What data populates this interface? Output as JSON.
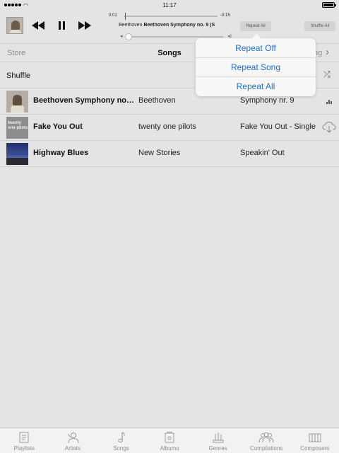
{
  "status_bar": {
    "time": "11:17",
    "battery_level": 1.0
  },
  "now_playing": {
    "elapsed": "0:01",
    "remaining": "-0:15",
    "progress": 0.01,
    "title_artist": "Beethoven",
    "title_track": "Beethoven Symphony no. 9 (S",
    "volume": 0.03,
    "repeat_label": "Repeat All",
    "shuffle_label": "Shuffle All"
  },
  "segment_bar": {
    "store": "Store",
    "title": "Songs",
    "right_label": "ng"
  },
  "shuffle_row": {
    "label": "Shuffle"
  },
  "songs": [
    {
      "title": "Beethoven Symphony no.…",
      "artist": "Beethoven",
      "album": "Symphony nr. 9",
      "status": "playing"
    },
    {
      "title": "Fake You Out",
      "artist": "twenty one pilots",
      "album": "Fake You Out - Single",
      "status": "cloud",
      "art_text": "twenty one pilots"
    },
    {
      "title": "Highway Blues",
      "artist": "New Stories",
      "album": "Speakin' Out",
      "status": ""
    }
  ],
  "repeat_menu": {
    "items": [
      "Repeat Off",
      "Repeat Song",
      "Repeat All"
    ]
  },
  "tabs": [
    {
      "label": "Playlists",
      "icon": "playlists-icon"
    },
    {
      "label": "Artists",
      "icon": "artists-icon"
    },
    {
      "label": "Songs",
      "icon": "songs-icon"
    },
    {
      "label": "Albums",
      "icon": "albums-icon"
    },
    {
      "label": "Genres",
      "icon": "genres-icon"
    },
    {
      "label": "Compilations",
      "icon": "compilations-icon"
    },
    {
      "label": "Composers",
      "icon": "composers-icon"
    }
  ],
  "colors": {
    "accent": "#1f6fd6",
    "background": "#e4e4e4",
    "tab_inactive": "#8a8a8a"
  }
}
